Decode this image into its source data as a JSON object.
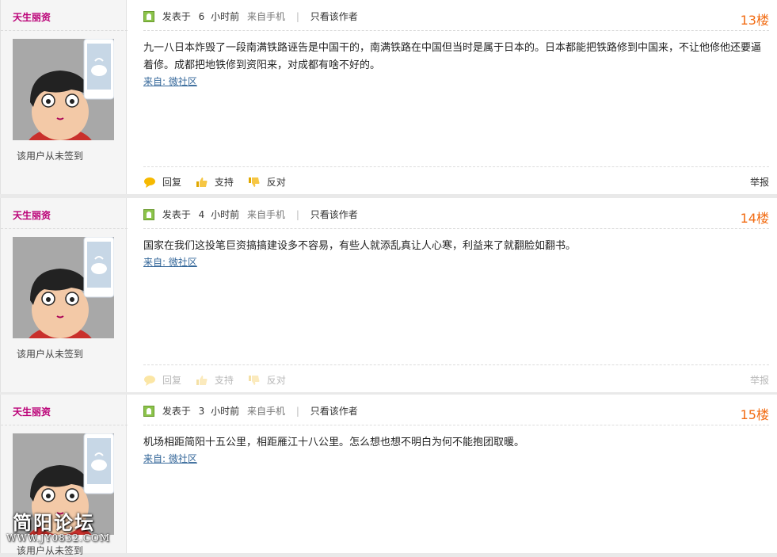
{
  "labels": {
    "posted_prefix": "发表于",
    "hours_ago": "小时前",
    "from_mobile": "来自手机",
    "sep": "|",
    "only_author": "只看该作者",
    "sign_status": "该用户从未签到",
    "source": "来自: 微社区",
    "reply": "回复",
    "support": "支持",
    "oppose": "反对",
    "report": "举报"
  },
  "posts": [
    {
      "author": "天生丽资",
      "hours": "6",
      "floor": "13楼",
      "content": "九一八日本炸毁了一段南满铁路诬告是中国干的，南满铁路在中国但当时是属于日本的。日本都能把铁路修到中国来，不让他修他还要逼着修。成都把地铁修到资阳来，对成都有啥不好的。"
    },
    {
      "author": "天生丽资",
      "hours": "4",
      "floor": "14楼",
      "content": "国家在我们这投笔巨资搞搞建设多不容易，有些人就添乱真让人心寒，利益来了就翻脸如翻书。"
    },
    {
      "author": "天生丽资",
      "hours": "3",
      "floor": "15楼",
      "content": "机场相距简阳十五公里，相距雁江十八公里。怎么想也想不明白为何不能抱团取暖。"
    }
  ],
  "watermark": {
    "title": "简阳论坛",
    "url": "WWW.JY0832.COM"
  },
  "colors": {
    "author": "#bb0077",
    "floor": "#f26c13",
    "link": "#336699"
  }
}
